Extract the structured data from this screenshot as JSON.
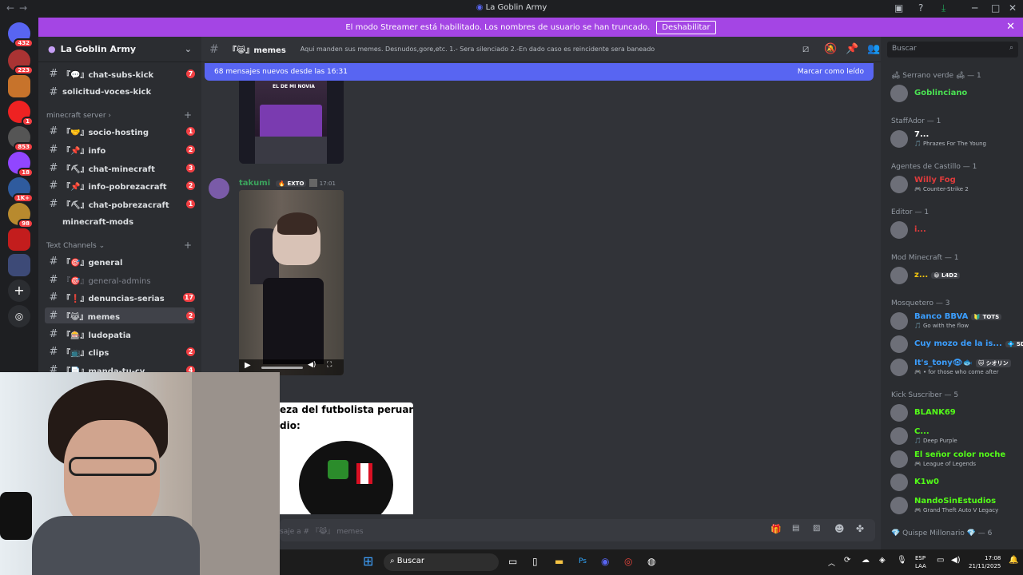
{
  "window": {
    "title": "La Goblin Army"
  },
  "banner": {
    "text": "El modo Streamer está habilitado. Los nombres de usuario se han truncado.",
    "button": "Deshabilitar"
  },
  "servers": [
    {
      "badge": "432"
    },
    {
      "badge": "223"
    },
    {
      "badge": ""
    },
    {
      "badge": "1"
    },
    {
      "badge": "853"
    },
    {
      "badge": "18"
    },
    {
      "badge": "1K+"
    },
    {
      "badge": "98"
    },
    {
      "badge": ""
    },
    {
      "badge": ""
    }
  ],
  "guild": {
    "name": "La Goblin Army"
  },
  "channels_top": [
    {
      "name": "『💬』chat-subs-kick",
      "badge": "7"
    },
    {
      "name": "solicitud-voces-kick",
      "badge": ""
    }
  ],
  "cat_minecraft": "minecraft server",
  "channels_mc": [
    {
      "name": "『🤝』socio-hosting",
      "badge": "1"
    },
    {
      "name": "『📌』info",
      "badge": "2"
    },
    {
      "name": "『⛏』chat-minecraft",
      "badge": "3"
    },
    {
      "name": "『📌』info-pobrezacraft",
      "badge": "2"
    },
    {
      "name": "『⛏』chat-pobrezacraft",
      "badge": "1"
    },
    {
      "name": "minecraft-mods",
      "badge": ""
    }
  ],
  "cat_text": "Text Channels",
  "channels_text": [
    {
      "name": "『🎯』general",
      "badge": ""
    },
    {
      "name": "『🎯』general-admins",
      "badge": ""
    },
    {
      "name": "『❗』denuncias-serias",
      "badge": "17"
    },
    {
      "name": "『😹』memes",
      "badge": "2"
    },
    {
      "name": "『🎰』ludopatia",
      "badge": ""
    },
    {
      "name": "『📺』clips",
      "badge": "2"
    },
    {
      "name": "『📄』manda-tu-cv",
      "badge": "4"
    }
  ],
  "header": {
    "channel": "『😹』memes",
    "topic": "Aqui manden sus memes. Desnudos,gore,etc. 1.- Sera silenciado 2.-En dado caso es reincidente sera baneado",
    "search": "Buscar"
  },
  "newbar": {
    "text": "68 mensajes nuevos desde las 16:31",
    "action": "Marcar como leído"
  },
  "message": {
    "author": "takumi",
    "tag": "EXTO",
    "time": "17:01"
  },
  "img1_caption": "EL DE MI NOVIA",
  "meme": {
    "line1": "eza del futbolista peruano",
    "line2": "dio:"
  },
  "composer": {
    "placeholder": "saje a # 『😹』 memes"
  },
  "members": [
    {
      "role": "🛋 Serrano verde 🛋 — 1",
      "users": [
        {
          "name": "Goblinciano",
          "status": "",
          "color": "#4ae052"
        }
      ]
    },
    {
      "role": "StaffAdor — 1",
      "users": [
        {
          "name": "7...",
          "status": "🎵 Phrazes For The Young",
          "color": "#ffffff"
        }
      ]
    },
    {
      "role": "Agentes de Castillo — 1",
      "users": [
        {
          "name": "Willy Fog",
          "status": "🎮 Counter-Strike 2",
          "color": "#e03b3b"
        }
      ]
    },
    {
      "role": "Editor — 1",
      "users": [
        {
          "name": "i...",
          "status": "",
          "color": "#e03b3b"
        }
      ]
    },
    {
      "role": "Mod Minecraft — 1",
      "users": [
        {
          "name": "z...",
          "status": "",
          "tag": "😀 L4D2",
          "color": "#f1c40f"
        }
      ]
    },
    {
      "role": "Mosquetero — 3",
      "users": [
        {
          "name": "Banco BBVA",
          "status": "🎵 Go with the flow",
          "tag": "🔰 TOTS",
          "color": "#3b9eff"
        },
        {
          "name": "Cuy mozo de la is...",
          "status": "",
          "tag": "💠 SDLG",
          "color": "#3b9eff"
        },
        {
          "name": "It's_tony👁🐟",
          "status": "🎮 • for those who come after",
          "tag": "🐱 シオリン",
          "color": "#3b9eff"
        }
      ]
    },
    {
      "role": "Kick Suscriber — 5",
      "users": [
        {
          "name": "BLANK69",
          "status": "",
          "color": "#53fc18"
        },
        {
          "name": "C...",
          "status": "🎵 Deep Purple",
          "color": "#53fc18"
        },
        {
          "name": "El señor color noche",
          "status": "🎮 League of Legends",
          "color": "#53fc18"
        },
        {
          "name": "K1w0",
          "status": "",
          "color": "#53fc18"
        },
        {
          "name": "NandoSinEstudios",
          "status": "🎮 Grand Theft Auto V Legacy",
          "color": "#53fc18"
        }
      ]
    },
    {
      "role": "💎 Quispe Millonario 💎 — 6",
      "users": []
    }
  ],
  "taskbar": {
    "search": "Buscar",
    "lang": "ESP",
    "lang2": "LAA",
    "time": "17:08",
    "date": "21/11/2025"
  }
}
